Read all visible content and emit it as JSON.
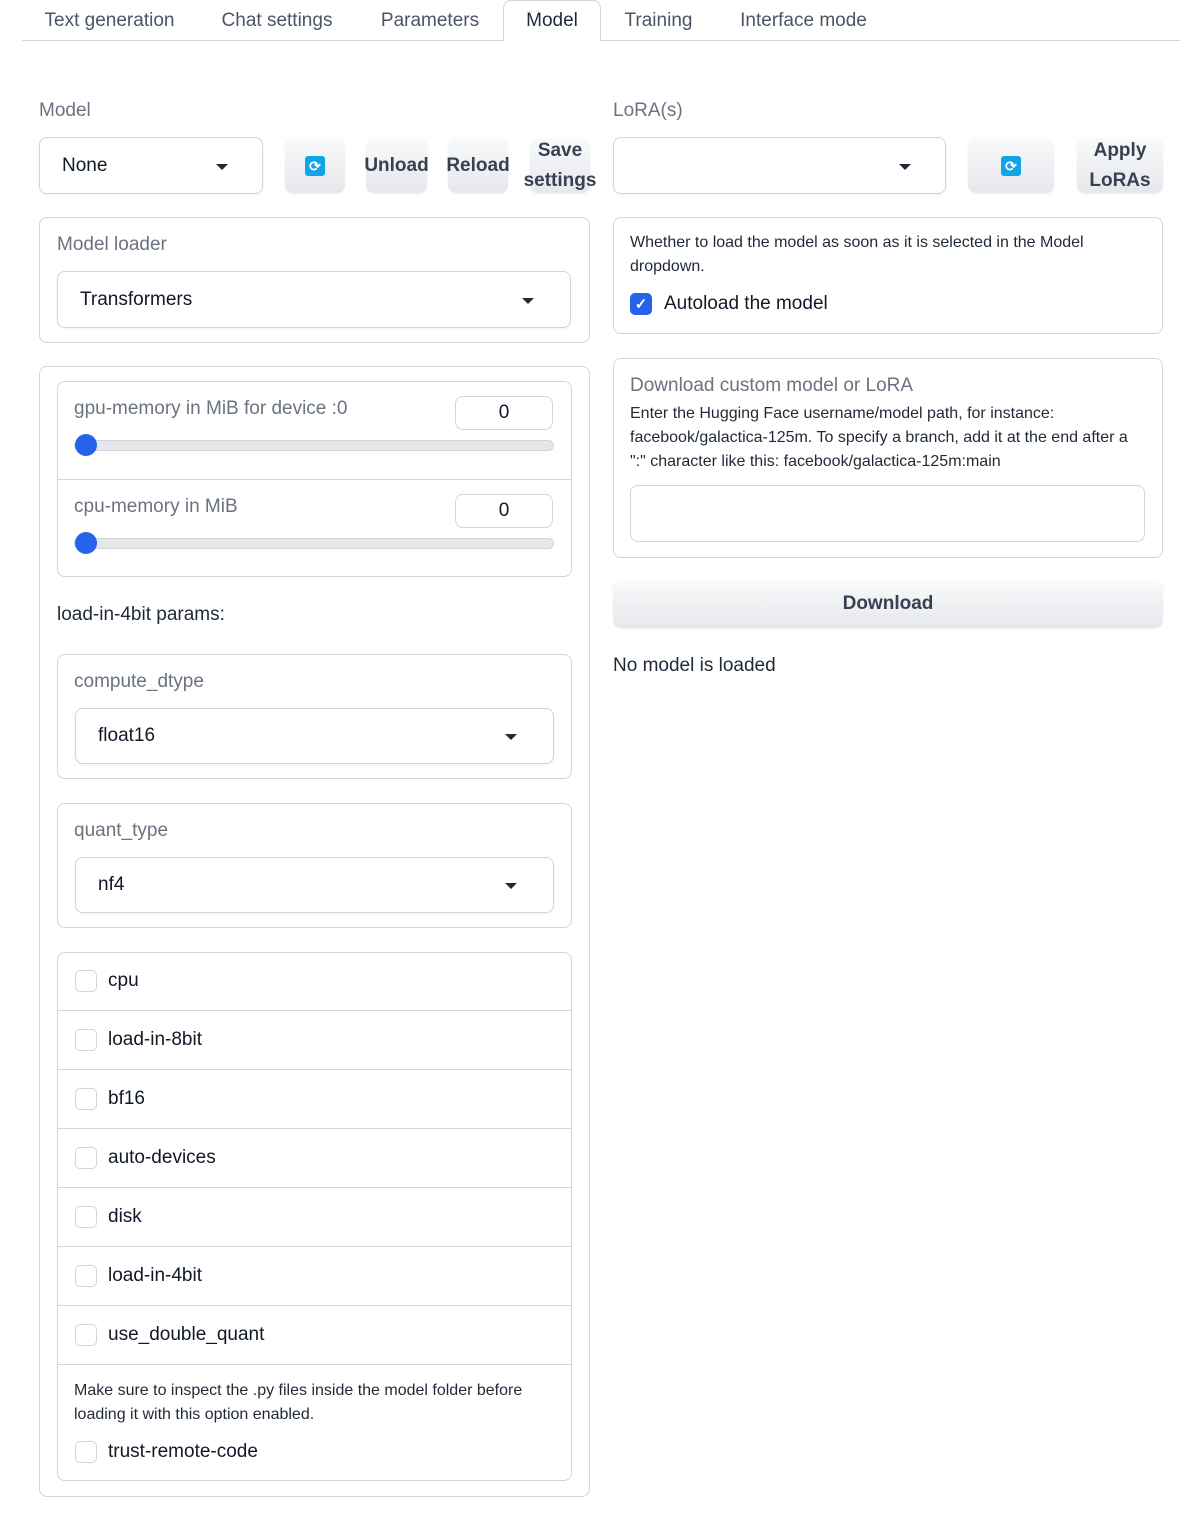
{
  "tabs": [
    {
      "label": "Text generation"
    },
    {
      "label": "Chat settings"
    },
    {
      "label": "Parameters"
    },
    {
      "label": "Model"
    },
    {
      "label": "Training"
    },
    {
      "label": "Interface mode"
    }
  ],
  "model": {
    "label": "Model",
    "selected": "None",
    "refresh_icon": "refresh-icon",
    "unload_label": "Unload",
    "reload_label": "Reload",
    "save_label_line1": "Save",
    "save_label_line2": "settings"
  },
  "lora": {
    "label": "LoRA(s)",
    "selected": "",
    "apply_line1": "Apply",
    "apply_line2": "LoRAs"
  },
  "loader": {
    "label": "Model loader",
    "selected": "Transformers"
  },
  "autoload": {
    "info": "Whether to load the model as soon as it is selected in the Model dropdown.",
    "label": "Autoload the model",
    "checked": true
  },
  "gpu_memory": {
    "label": "gpu-memory in MiB for device :0",
    "value": "0"
  },
  "cpu_memory": {
    "label": "cpu-memory in MiB",
    "value": "0"
  },
  "download": {
    "label": "Download custom model or LoRA",
    "info": "Enter the Hugging Face username/model path, for instance: facebook/galactica-125m. To specify a branch, add it at the end after a \":\" character like this: facebook/galactica-125m:main",
    "input_value": "",
    "button_label": "Download"
  },
  "status": "No model is loaded",
  "params_4bit_label": "load-in-4bit params:",
  "compute_dtype": {
    "label": "compute_dtype",
    "selected": "float16"
  },
  "quant_type": {
    "label": "quant_type",
    "selected": "nf4"
  },
  "checkboxes": [
    {
      "label": "cpu",
      "checked": false
    },
    {
      "label": "load-in-8bit",
      "checked": false
    },
    {
      "label": "bf16",
      "checked": false
    },
    {
      "label": "auto-devices",
      "checked": false
    },
    {
      "label": "disk",
      "checked": false
    },
    {
      "label": "load-in-4bit",
      "checked": false
    },
    {
      "label": "use_double_quant",
      "checked": false
    }
  ],
  "trust_remote": {
    "info": "Make sure to inspect the .py files inside the model folder before loading it with this option enabled.",
    "label": "trust-remote-code",
    "checked": false
  }
}
